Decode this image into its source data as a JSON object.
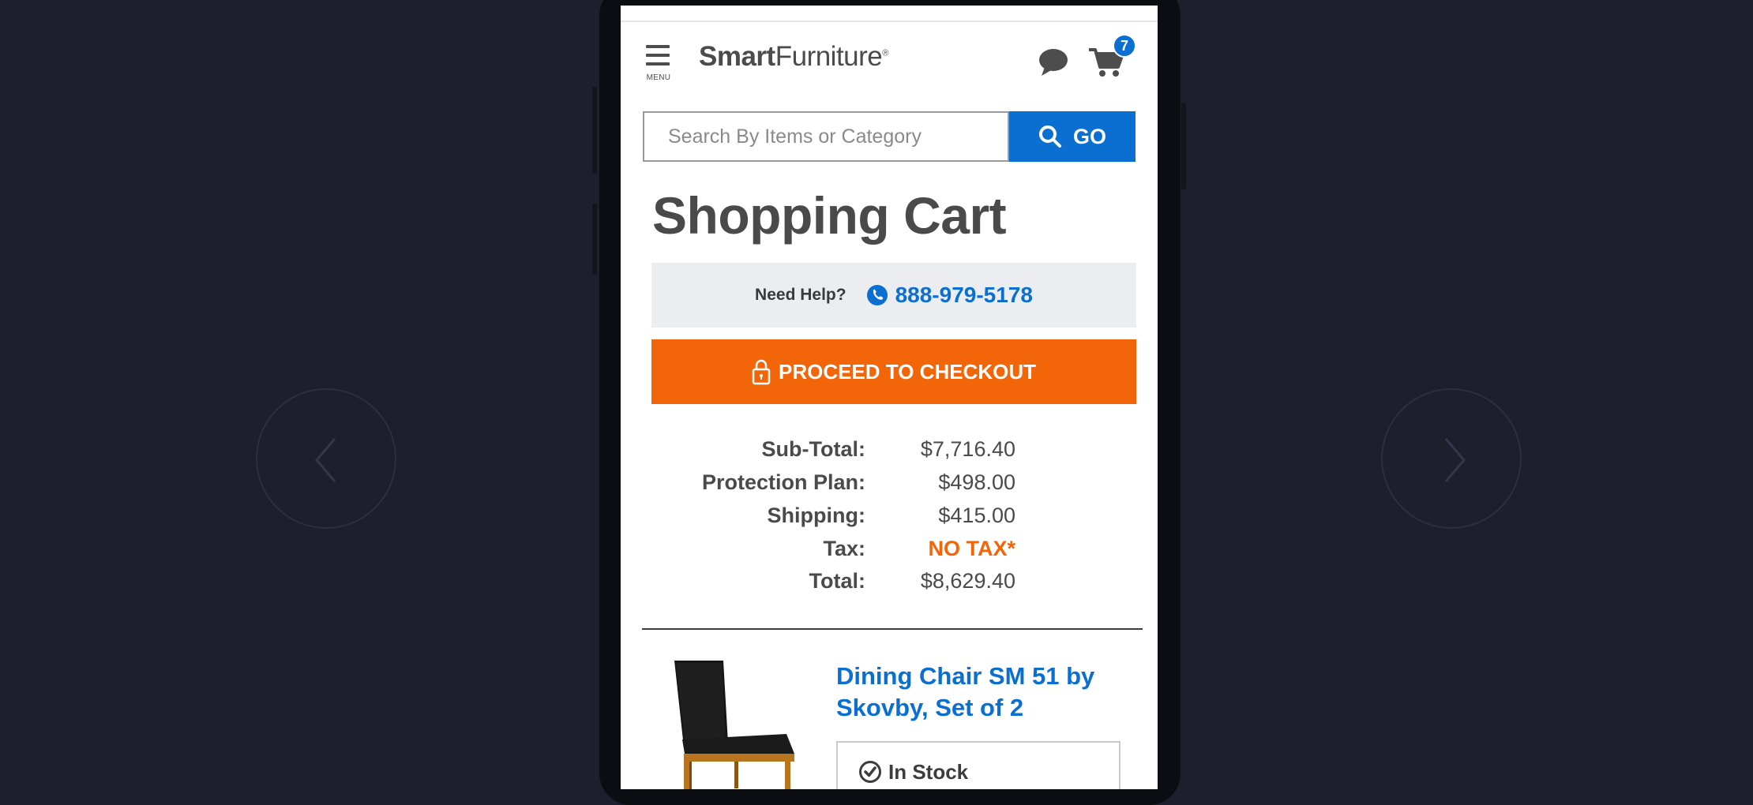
{
  "header": {
    "menu_label": "MENU",
    "logo_bold": "Smart",
    "logo_light": "Furniture",
    "logo_reg": "®",
    "cart_count": "7"
  },
  "search": {
    "placeholder": "Search By Items or Category",
    "go_label": "GO"
  },
  "page_title": "Shopping Cart",
  "help": {
    "label": "Need Help?",
    "phone": "888-979-5178"
  },
  "checkout_label": "PROCEED TO CHECKOUT",
  "summary": {
    "rows": [
      {
        "label": "Sub-Total:",
        "value": "$7,716.40"
      },
      {
        "label": "Protection Plan:",
        "value": "$498.00"
      },
      {
        "label": "Shipping:",
        "value": "$415.00"
      },
      {
        "label": "Tax:",
        "value": "NO TAX*"
      },
      {
        "label": "Total:",
        "value": "$8,629.40"
      }
    ]
  },
  "product": {
    "title": "Dining Chair SM 51 by Skovby, Set of 2",
    "stock": "In Stock"
  },
  "colors": {
    "accent_blue": "#0b6fd1",
    "checkout_orange": "#f26509",
    "background": "#1d1f2d"
  }
}
